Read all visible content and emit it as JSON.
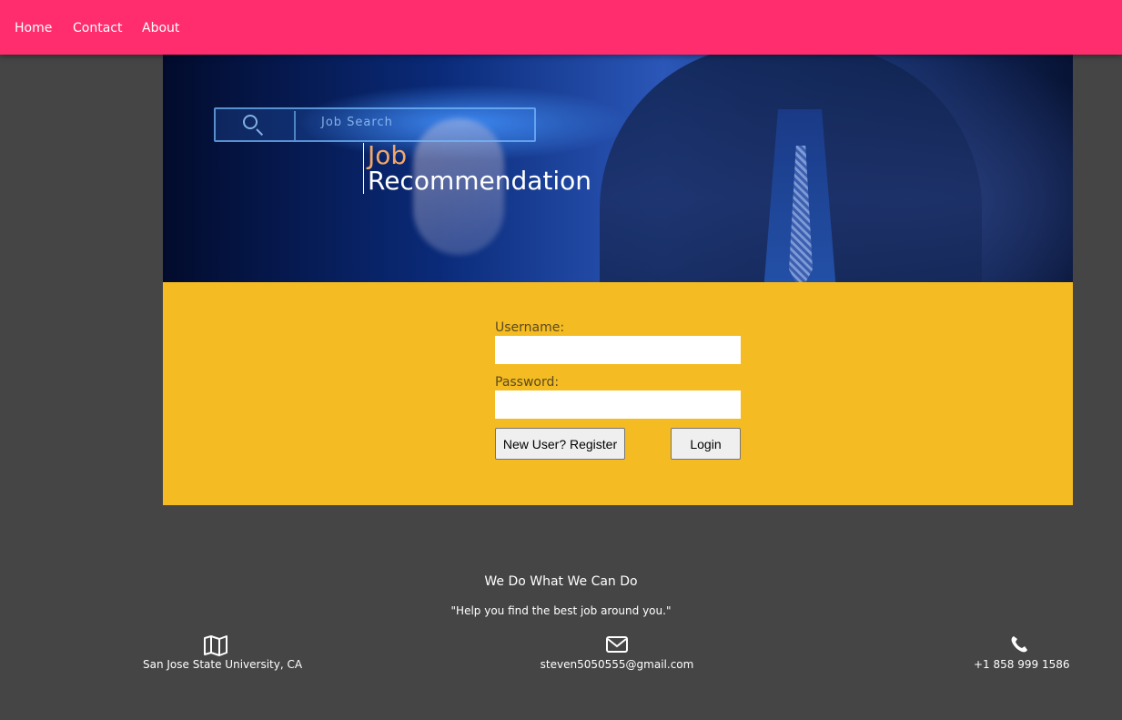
{
  "nav": {
    "links": [
      {
        "label": "Home"
      },
      {
        "label": "Contact"
      },
      {
        "label": "About"
      }
    ]
  },
  "hero": {
    "title_line1": "Job",
    "title_line2": "Recommendation",
    "search_graphic_text": "Job Search"
  },
  "login": {
    "username_label": "Username:",
    "username_value": "",
    "password_label": "Password:",
    "password_value": "",
    "register_label": "New User? Register",
    "login_label": "Login"
  },
  "footer": {
    "title": "We Do What We Can Do",
    "quote": "\"Help you find the best job around you.\"",
    "location": {
      "icon": "map-icon",
      "text": "San Jose State University, CA"
    },
    "email": {
      "icon": "envelope-icon",
      "text": "steven5050555@gmail.com"
    },
    "phone": {
      "icon": "phone-icon",
      "text": "+1 858 999 1586"
    }
  },
  "colors": {
    "nav_bg": "#ff2d6e",
    "page_bg": "#454545",
    "panel_bg": "#f4bb22",
    "title_accent": "#f1a768"
  }
}
